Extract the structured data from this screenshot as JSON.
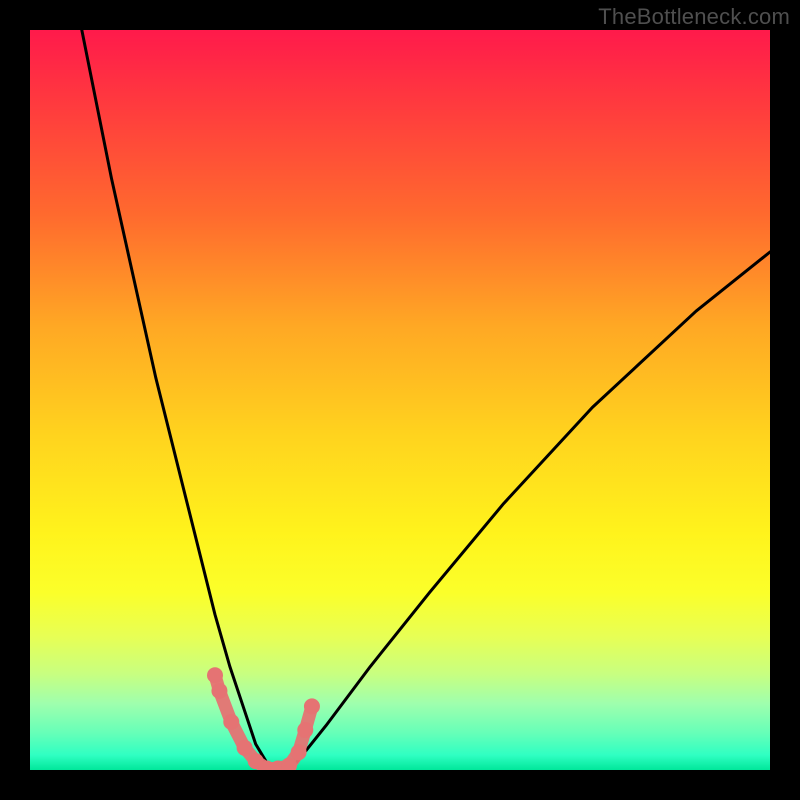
{
  "watermark": "TheBottleneck.com",
  "chart_data": {
    "type": "line",
    "title": "",
    "xlabel": "",
    "ylabel": "",
    "xlim": [
      0,
      100
    ],
    "ylim": [
      0,
      100
    ],
    "background_gradient": {
      "top": "#ff1a4b",
      "mid": "#fff31c",
      "bottom": "#00e79a",
      "meaning": "top=high bottleneck, bottom=low bottleneck"
    },
    "series": [
      {
        "name": "bottleneck-curve",
        "color": "#000000",
        "x": [
          7,
          9,
          11,
          13,
          15,
          17,
          19,
          21,
          23,
          25,
          27,
          29,
          30.5,
          32,
          34,
          36,
          40,
          46,
          54,
          64,
          76,
          90,
          100
        ],
        "values": [
          100,
          90,
          80,
          71,
          62,
          53,
          45,
          37,
          29,
          21,
          14,
          8,
          3.5,
          1,
          0,
          1,
          6,
          14,
          24,
          36,
          49,
          62,
          70
        ]
      },
      {
        "name": "highlight-markers",
        "color": "#e57373",
        "style": "marker",
        "x": [
          25,
          25.6,
          27.2,
          29,
          30.5,
          32,
          33.5,
          35,
          36.3,
          37.2,
          38.1
        ],
        "values": [
          12.8,
          10.7,
          6.5,
          3.0,
          1.2,
          0.2,
          0.2,
          0.6,
          2.4,
          5.4,
          8.6
        ]
      }
    ],
    "annotations": []
  }
}
